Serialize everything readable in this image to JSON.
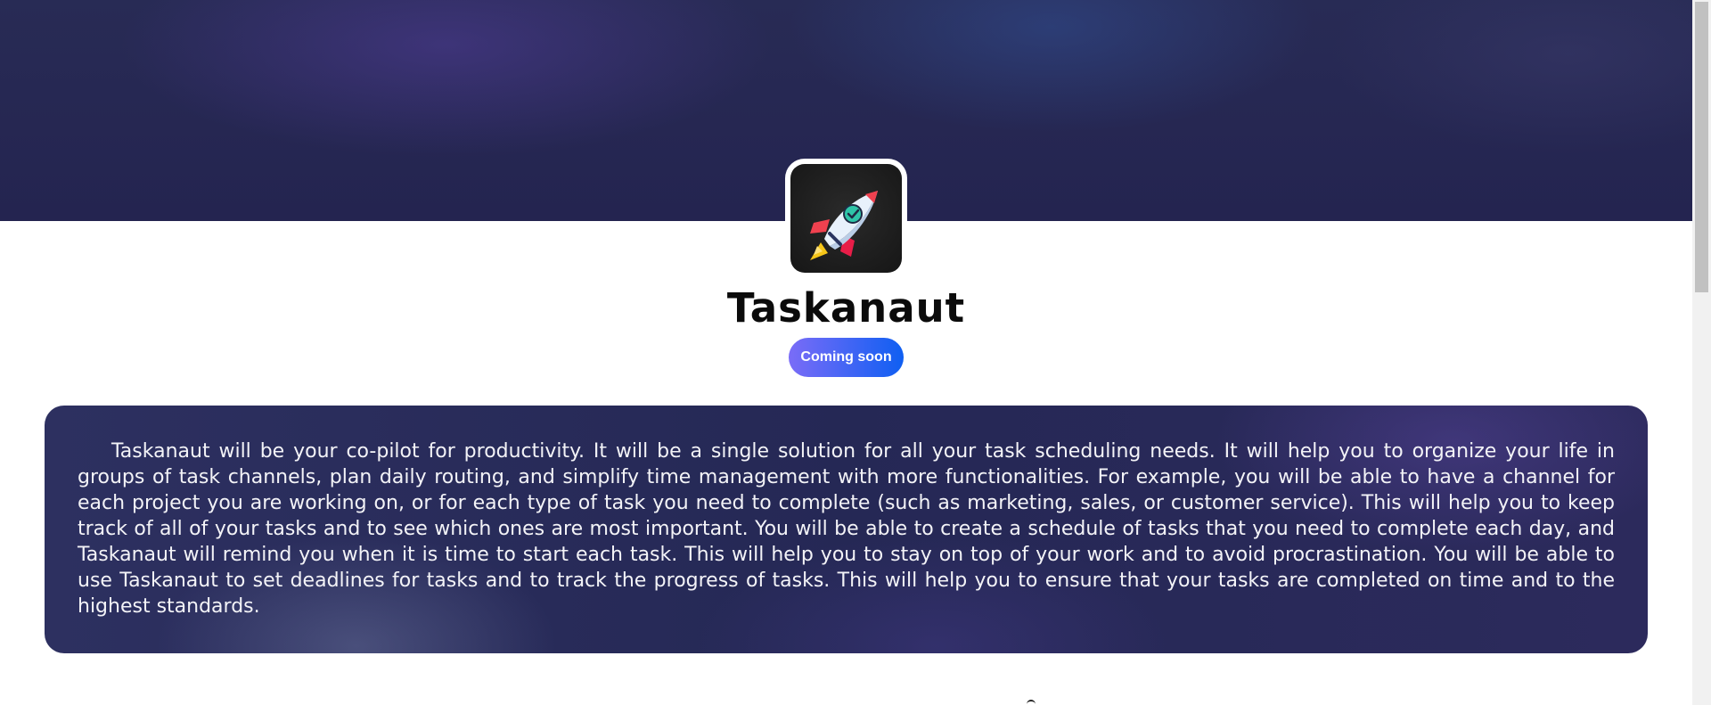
{
  "app": {
    "name": "Taskanaut",
    "status_badge": "Coming soon",
    "logo_icon": "rocket-icon",
    "description": "Taskanaut will be your co-pilot for productivity. It will be a single solution for all your task scheduling needs. It will help you to organize your life in groups of task channels, plan daily routing, and simplify time management with more functionalities. For example, you will be able to have a channel for each project you are working on, or for each type of task you need to complete (such as marketing, sales, or customer service). This will help you to keep track of all of your tasks and to see which ones are most important. You will be able to create a schedule of tasks that you need to complete each day, and Taskanaut will remind you when it is time to start each task. This will help you to stay on top of your work and to avoid procrastination. You will be able to use Taskanaut to set deadlines for tasks and to track the progress of tasks. This will help you to ensure that your tasks are completed on time and to the highest standards."
  },
  "colors": {
    "hero_bg": "#262852",
    "badge_gradient_start": "#7a6cf7",
    "badge_gradient_end": "#0f5ff2",
    "card_bg": "#272a58",
    "card_text": "#f3f3f7",
    "title_text": "#0b0b0b"
  }
}
